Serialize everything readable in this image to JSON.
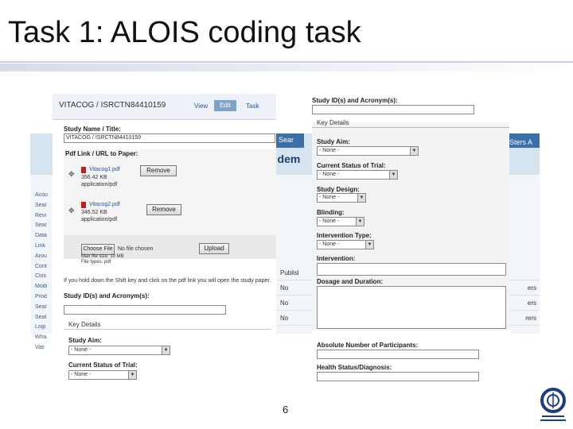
{
  "slide": {
    "title": "Task 1: ALOIS coding task",
    "page_number": "6"
  },
  "background_site": {
    "banner_text": "f dem",
    "mid_nav": "Sear",
    "right_nav": "Sters A",
    "side_nav": [
      "Acou",
      "Seat",
      "Revi",
      "Sear",
      "Data",
      "Link",
      "Arou",
      "Cont",
      "Clos",
      "Modi",
      "Prod",
      "Seat",
      "Seat",
      "Logi",
      "Wha",
      "Vatr"
    ],
    "table_header": "Publisl",
    "table_rows": [
      {
        "left": "No",
        "right": "ers"
      },
      {
        "left": "No",
        "right": "ers"
      },
      {
        "left": "No",
        "right": "rers"
      }
    ]
  },
  "left_form": {
    "record_id": "VITACOG / ISRCTN84410159",
    "nav_view": "View",
    "nav_edit": "Edit",
    "nav_task": "Task",
    "study_name_label": "Study Name / Title:",
    "study_name_value": "VITACOG / ISRCTN84410159",
    "pdf_label": "Pdf Link / URL to Paper:",
    "file1_name": "Vitacog1.pdf",
    "file1_size": "356.42 KB",
    "file1_type": "application/pdf",
    "file2_name": "Vitacog2.pdf",
    "file2_size": "346.52 KB",
    "file2_type": "application/pdf",
    "remove_label": "Remove",
    "choose_file_label": "Choose File",
    "no_file_label": "No file chosen",
    "upload_hint1": "Max file size: 10 MB",
    "upload_hint2": "File types: pdf",
    "upload_label": "Upload",
    "note": "If you hold down the Shift key and click on the pdf link you will open the study paper.",
    "study_ids_label": "Study ID(s) and Acronym(s):",
    "key_details_label": "Key Details",
    "study_aim_label": "Study Aim:",
    "study_aim_value": "- None -",
    "trial_status_label": "Current Status of Trial:",
    "trial_status_value": "- None -"
  },
  "right_form": {
    "study_ids_label": "Study ID(s) and Acronym(s):",
    "key_details_label": "Key Details",
    "study_aim_label": "Study Aim:",
    "study_aim_value": "- None -",
    "trial_status_label": "Current Status of Trial:",
    "trial_status_value": "- None -",
    "study_design_label": "Study Design:",
    "study_design_value": "- None -",
    "blinding_label": "Blinding:",
    "blinding_value": "- None -",
    "intervention_type_label": "Intervention Type:",
    "intervention_type_value": "- None -",
    "intervention_label": "Intervention:",
    "dosage_label": "Dosage and Duration:",
    "participants_label": "Absolute Number of Participants:",
    "health_status_label": "Health Status/Diagnosis:"
  },
  "colors": {
    "accent": "#3c6ea8",
    "title_rule": "#c9cfe0"
  },
  "icons": [
    "pdf-icon",
    "plus-icon",
    "dropdown-arrow-icon",
    "organization-logo-icon"
  ]
}
